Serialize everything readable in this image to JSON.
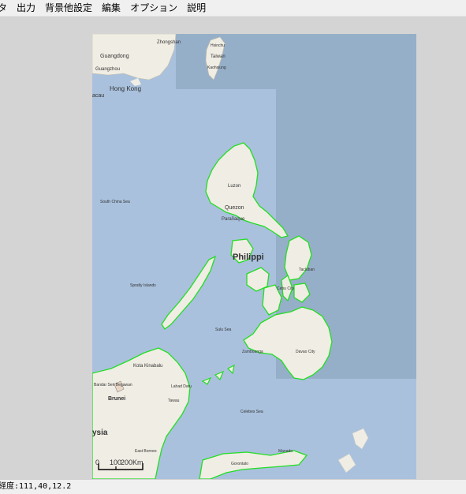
{
  "menu": {
    "items": [
      {
        "label": "タ"
      },
      {
        "label": "出力"
      },
      {
        "label": "背景他設定"
      },
      {
        "label": "編集"
      },
      {
        "label": "オプション"
      },
      {
        "label": "説明"
      }
    ]
  },
  "map": {
    "labels": {
      "zhongshan": "Zhongshan",
      "guangdong": "Guangdong",
      "guangzhou": "Guangzhou",
      "hong_kong": "Hong Kong",
      "macau": "acau",
      "taiwan": "Taiwan",
      "hsinchu": "Hsinchu",
      "taichung": "Taichung",
      "kaohsiung": "Kaohsiung",
      "south_china_sea": "South China Sea",
      "luzon": "Luzon",
      "quezon": "Quezon",
      "paranaque": "Parañaque",
      "philippines": "Philippi",
      "spratly": "Spratly Islands",
      "sulu_sea": "Sulu Sea",
      "kota_kinabalu": "Kota Kinabalu",
      "bandar": "Bandar Seri Begawan",
      "brunei": "Brunei",
      "malaysia": "ysia",
      "tawau": "Tawau",
      "sandakan": "Lahad Datu",
      "celebes_sea": "Celebes Sea",
      "east_borneo": "East Borneo",
      "manado": "Manado",
      "gorontalo": "Gorontalo",
      "davao": "Davao City",
      "cebu": "Cebu City",
      "tacloban": "Tacloban",
      "zamboanga": "Zamboanga"
    },
    "scale": {
      "zero": "0",
      "hundred": "100",
      "two_hundred": "200Km"
    },
    "colors": {
      "sea": "#a9c1dd",
      "land": "#f0ede4",
      "outline": "#22dd22",
      "overlay": "#8fa8c3"
    }
  },
  "status": {
    "text": "経度:111,40,12.2"
  }
}
